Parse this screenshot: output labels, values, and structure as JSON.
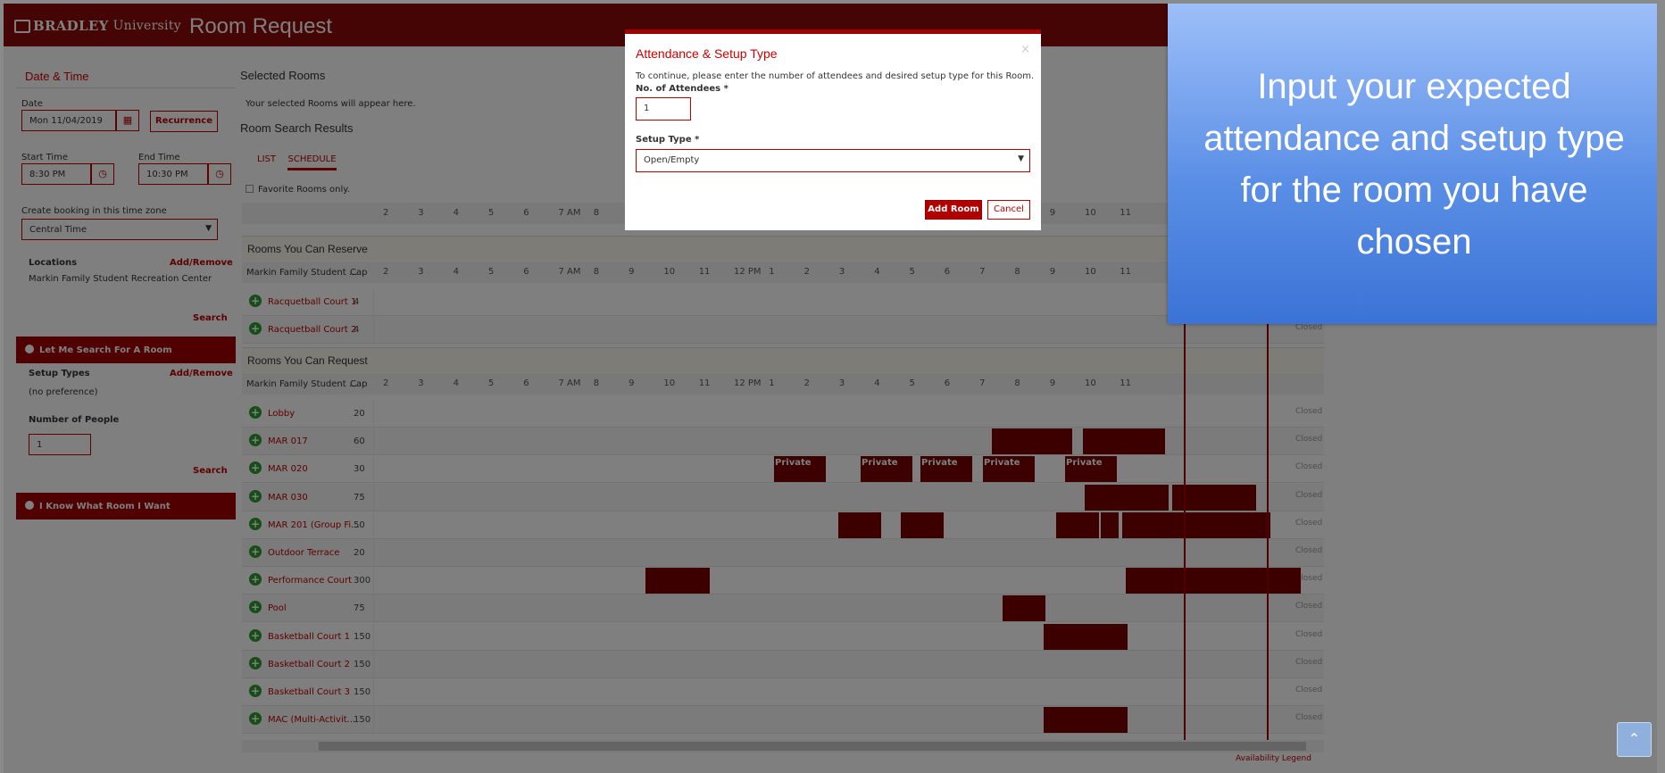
{
  "header": {
    "brand_name": "BRADLEY",
    "brand_sub": "University",
    "app_title": "Room Request"
  },
  "left": {
    "heading": "Date & Time",
    "date_label": "Date",
    "date_value": "Mon 11/04/2019",
    "recurrence": "Recurrence",
    "start_label": "Start Time",
    "start_value": "8:30 PM",
    "end_label": "End Time",
    "end_value": "10:30 PM",
    "tz_label": "Create booking in this time zone",
    "tz_value": "Central Time",
    "locations_label": "Locations",
    "add_remove": "Add/Remove",
    "location_value": "Markin Family Student Recreation Center",
    "search": "Search",
    "let_me_search": "Let Me Search For A Room",
    "setup_types_label": "Setup Types",
    "setup_types_value": "(no preference)",
    "people_label": "Number of People",
    "people_value": "1",
    "know_room": "I Know What Room I Want"
  },
  "main": {
    "selected_title": "Selected Rooms",
    "selected_msg": "Your selected Rooms will appear here.",
    "results_title": "Room Search Results",
    "tab_list": "LIST",
    "tab_schedule": "SCHEDULE",
    "favorites": "Favorite Rooms only.",
    "reserve_title": "Rooms You Can Reserve",
    "request_title": "Rooms You Can Request",
    "group_col": "Markin Family Student ...",
    "cap_col": "Cap",
    "closed": "Closed",
    "private": "Private",
    "legend_link": "Availability Legend",
    "hours": [
      "2",
      "3",
      "4",
      "5",
      "6",
      "7 AM",
      "8",
      "9",
      "10",
      "11",
      "12 PM",
      "1",
      "2",
      "3",
      "4",
      "5",
      "6",
      "7",
      "8",
      "9",
      "10",
      "11"
    ],
    "reserve_rooms": [
      {
        "name": "Racquetball Court 1",
        "cap": "4"
      },
      {
        "name": "Racquetball Court 2",
        "cap": "4"
      }
    ],
    "request_rooms": [
      {
        "name": "Lobby",
        "cap": "20"
      },
      {
        "name": "MAR 017",
        "cap": "60"
      },
      {
        "name": "MAR 020",
        "cap": "30"
      },
      {
        "name": "MAR 030",
        "cap": "75"
      },
      {
        "name": "MAR 201 (Group Fi...",
        "cap": "50"
      },
      {
        "name": "Outdoor Terrace",
        "cap": "20"
      },
      {
        "name": "Performance Court",
        "cap": "300"
      },
      {
        "name": "Pool",
        "cap": "75"
      },
      {
        "name": "Basketball Court 1",
        "cap": "150"
      },
      {
        "name": "Basketball Court 2",
        "cap": "150"
      },
      {
        "name": "Basketball Court 3",
        "cap": "150"
      },
      {
        "name": "MAC (Multi-Activit...",
        "cap": "150"
      }
    ]
  },
  "modal": {
    "title": "Attendance & Setup Type",
    "instructions": "To continue, please enter the number of attendees and desired setup type for this Room.",
    "attendees_label": "No. of Attendees *",
    "attendees_value": "1",
    "setup_label": "Setup Type *",
    "setup_value": "Open/Empty",
    "add_room": "Add Room",
    "cancel": "Cancel"
  },
  "callout": {
    "text": "Input your expected attendance and setup type for the room you have chosen"
  },
  "colors": {
    "brand": "#8c0a0a",
    "reservation": "#7a0000",
    "callout_top": "#9dbff9",
    "callout_bottom": "#3b73d6"
  }
}
